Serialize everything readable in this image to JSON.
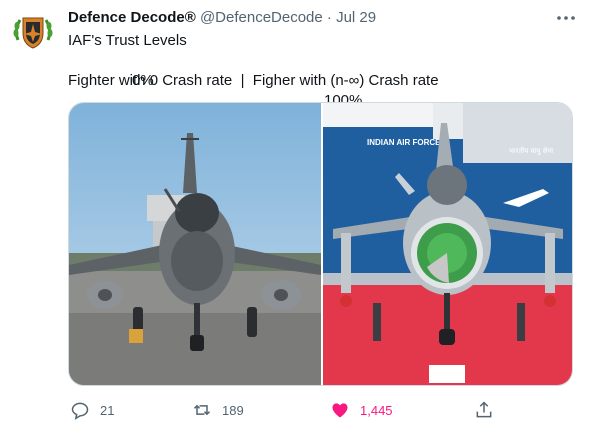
{
  "tweet": {
    "display_name": "Defence Decode®",
    "handle": "@DefenceDecode",
    "separator": "·",
    "date": "Jul 29",
    "text_line1": "IAF's Trust Levels",
    "pct_left": "0%",
    "pct_right": "100%",
    "text_line3": "Fighter with 0 Crash rate  |  Figher with (n-∞) Crash rate"
  },
  "media": {
    "right_banner_text": "INDIAN AIR FORCE",
    "right_banner_hindi": "भारतीय वायु सेना"
  },
  "actions": {
    "reply_count": "21",
    "retweet_count": "189",
    "like_count": "1,445"
  },
  "colors": {
    "like_pink": "#f91880",
    "secondary_text": "#536471",
    "sky_blue": "#9cc2de",
    "iaf_blue": "#1f5fa0",
    "red_carpet": "#e3384b"
  },
  "icons": [
    "avatar-logo",
    "more-icon",
    "reply-icon",
    "retweet-icon",
    "like-icon",
    "share-icon"
  ]
}
